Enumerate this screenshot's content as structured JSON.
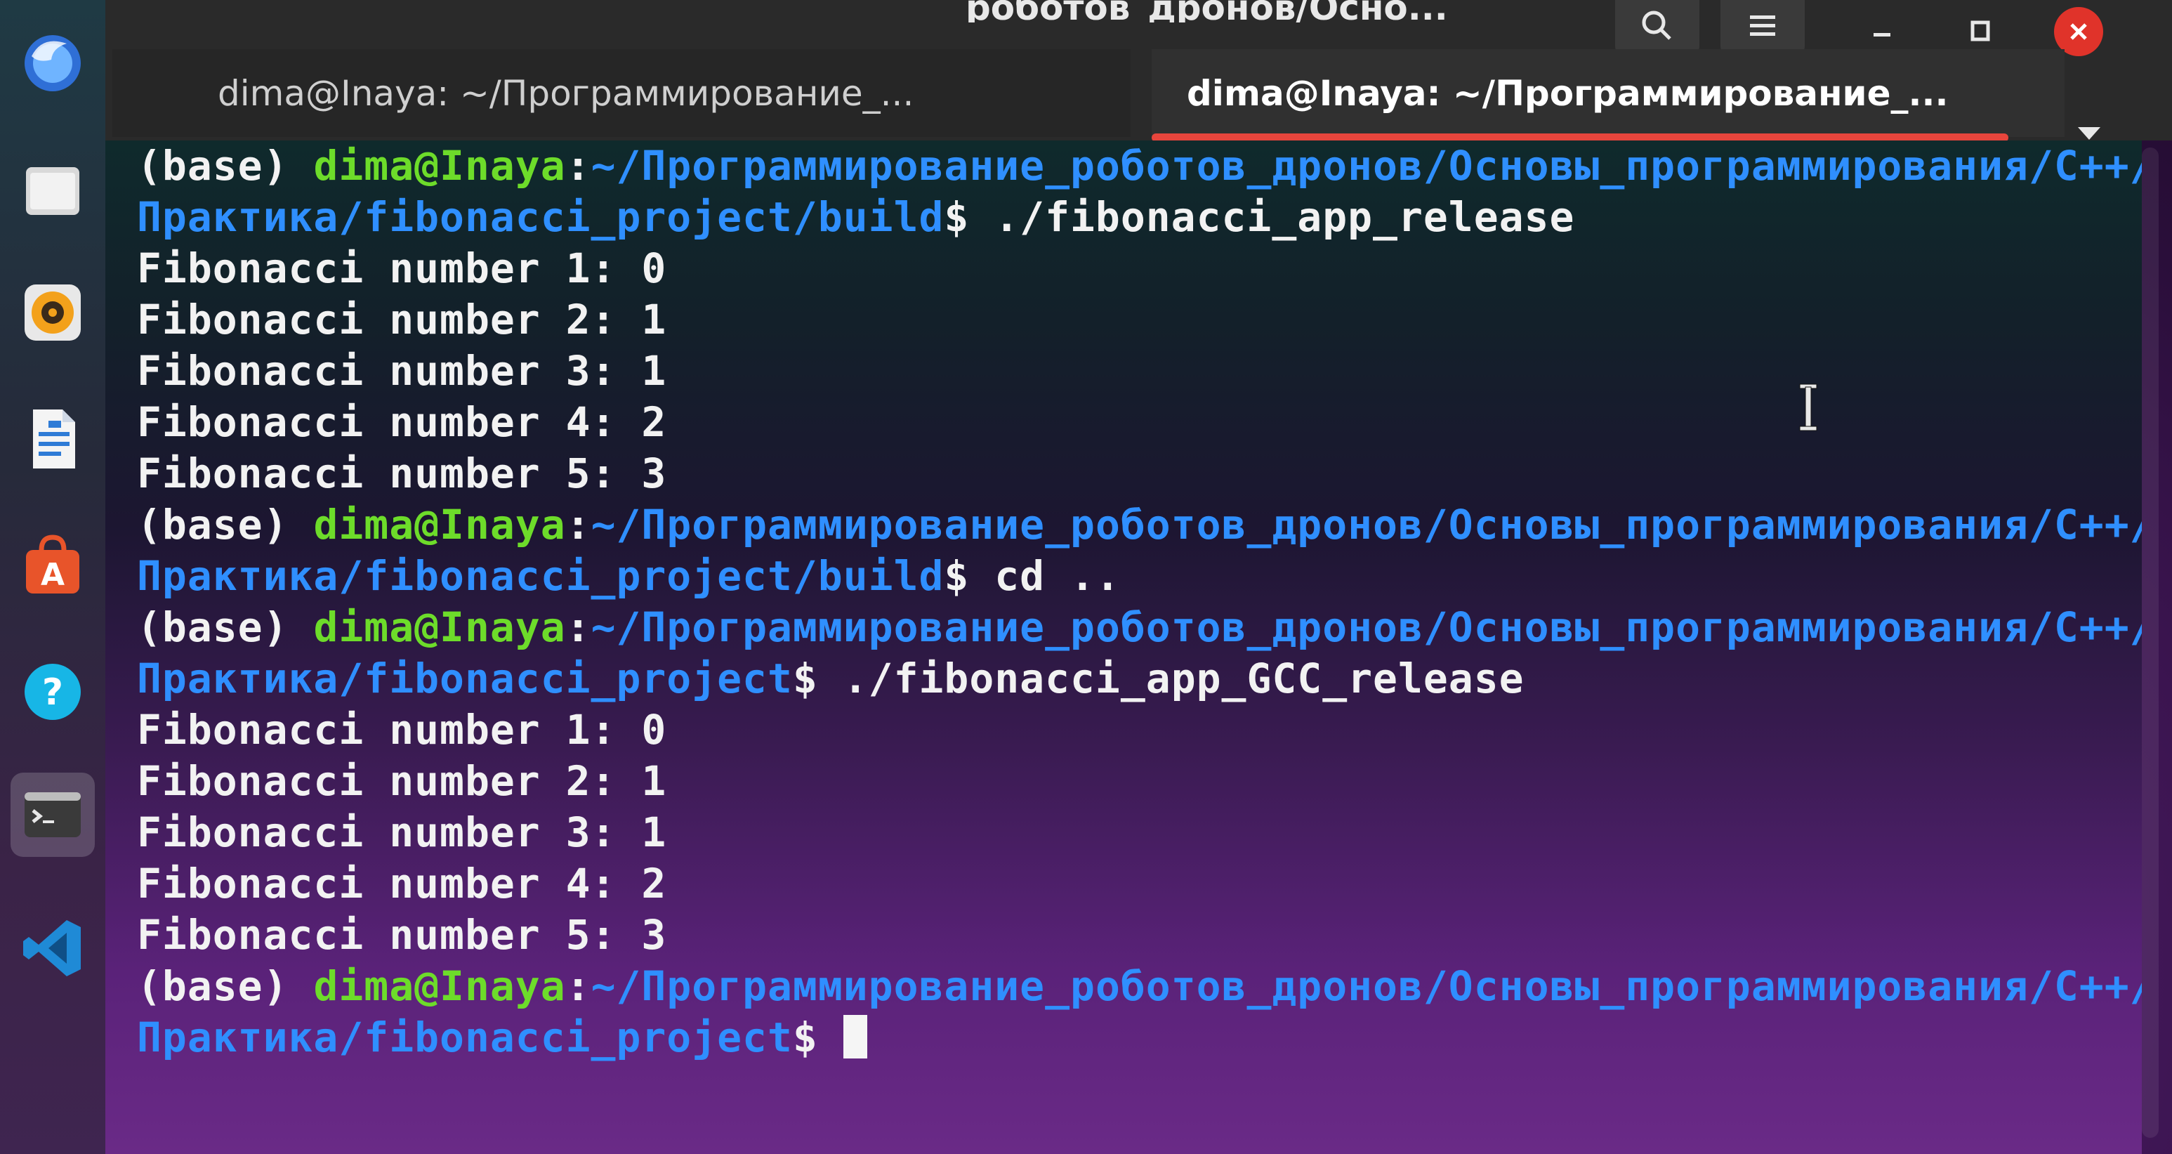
{
  "window": {
    "title": "_роботов_дронов/Осно...",
    "controls": {
      "search_icon": "search-icon",
      "menu_icon": "hamburger-menu-icon",
      "minimize_icon": "minimize-icon",
      "maximize_icon": "maximize-icon",
      "close_icon": "close-icon"
    }
  },
  "tabs": [
    {
      "label": "dima@Inaya: ~/Программирование_..."
    },
    {
      "label": "dima@Inaya: ~/Программирование_..."
    }
  ],
  "dock": {
    "items": [
      {
        "name": "files",
        "icon": "folder-icon"
      },
      {
        "name": "rhythmbox",
        "icon": "music-icon"
      },
      {
        "name": "libreoffice-writer",
        "icon": "document-icon"
      },
      {
        "name": "ubuntu-software",
        "icon": "software-store-icon"
      },
      {
        "name": "help",
        "icon": "help-icon"
      },
      {
        "name": "terminal",
        "icon": "terminal-icon"
      },
      {
        "name": "vscode",
        "icon": "vscode-icon"
      }
    ]
  },
  "terminal": {
    "block1": {
      "prompt_base": "(base) ",
      "prompt_user": "dima@Inaya",
      "prompt_path_1": "~/Программирование_роботов_дронов/Основы_программирования/С++/",
      "prompt_path_2": "Практика/fibonacci_project/build",
      "command": " ./fibonacci_app_release",
      "output": [
        "Fibonacci number 1: 0",
        "Fibonacci number 2: 1",
        "Fibonacci number 3: 1",
        "Fibonacci number 4: 2",
        "Fibonacci number 5: 3"
      ]
    },
    "block2": {
      "prompt_base": "(base) ",
      "prompt_user": "dima@Inaya",
      "prompt_path_1": "~/Программирование_роботов_дронов/Основы_программирования/С++/",
      "prompt_path_2": "Практика/fibonacci_project/build",
      "command": " cd .."
    },
    "block3": {
      "prompt_base": "(base) ",
      "prompt_user": "dima@Inaya",
      "prompt_path_1": "~/Программирование_роботов_дронов/Основы_программирования/С++/",
      "prompt_path_2": "Практика/fibonacci_project",
      "command": " ./fibonacci_app_GCC_release",
      "output": [
        "Fibonacci number 1: 0",
        "Fibonacci number 2: 1",
        "Fibonacci number 3: 1",
        "Fibonacci number 4: 2",
        "Fibonacci number 5: 3"
      ]
    },
    "block4": {
      "prompt_base": "(base) ",
      "prompt_user": "dima@Inaya",
      "prompt_path_1": "~/Программирование_роботов_дронов/Основы_программирования/С++/",
      "prompt_path_2": "Практика/fibonacci_project",
      "command": " "
    },
    "colon": ":",
    "dollar": "$"
  },
  "colors": {
    "prompt_user": "#6ddc2a",
    "prompt_path": "#2f8fff",
    "text": "#f2f2f2",
    "tab_underline": "#e8453c",
    "close_button": "#e0332a"
  }
}
